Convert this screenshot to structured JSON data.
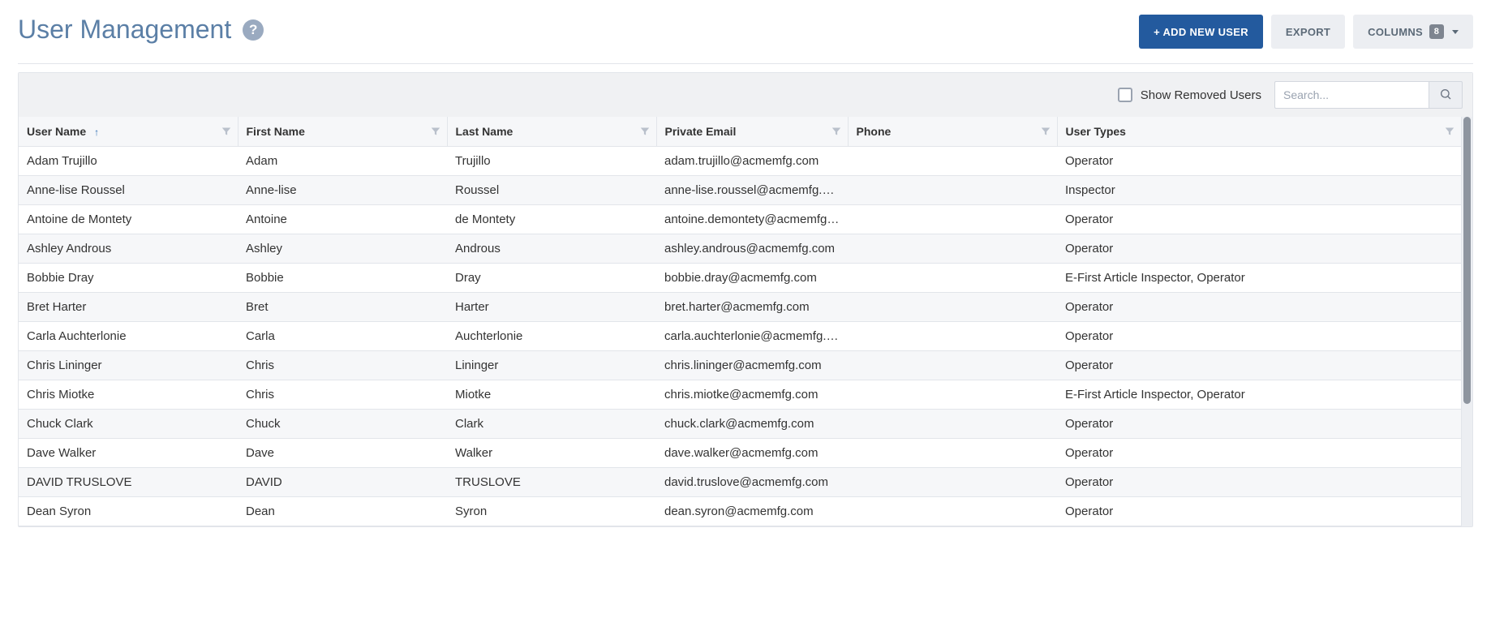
{
  "header": {
    "title": "User Management",
    "add_new_user_label": "+ ADD NEW USER",
    "export_label": "EXPORT",
    "columns_label": "COLUMNS",
    "columns_count": "8"
  },
  "toolbar": {
    "show_removed_label": "Show Removed Users",
    "search_placeholder": "Search..."
  },
  "table": {
    "columns": [
      {
        "key": "username",
        "label": "User Name",
        "sorted": "asc"
      },
      {
        "key": "first_name",
        "label": "First Name"
      },
      {
        "key": "last_name",
        "label": "Last Name"
      },
      {
        "key": "email",
        "label": "Private Email"
      },
      {
        "key": "phone",
        "label": "Phone"
      },
      {
        "key": "user_types",
        "label": "User Types"
      }
    ],
    "rows": [
      {
        "username": "Adam Trujillo",
        "first_name": "Adam",
        "last_name": "Trujillo",
        "email": "adam.trujillo@acmemfg.com",
        "phone": "",
        "user_types": "Operator"
      },
      {
        "username": "Anne-lise Roussel",
        "first_name": "Anne-lise",
        "last_name": "Roussel",
        "email": "anne-lise.roussel@acmemfg.com",
        "phone": "",
        "user_types": "Inspector"
      },
      {
        "username": "Antoine de Montety",
        "first_name": "Antoine",
        "last_name": "de Montety",
        "email": "antoine.demontety@acmemfg....",
        "phone": "",
        "user_types": "Operator"
      },
      {
        "username": "Ashley Androus",
        "first_name": "Ashley",
        "last_name": "Androus",
        "email": "ashley.androus@acmemfg.com",
        "phone": "",
        "user_types": "Operator"
      },
      {
        "username": "Bobbie Dray",
        "first_name": "Bobbie",
        "last_name": "Dray",
        "email": "bobbie.dray@acmemfg.com",
        "phone": "",
        "user_types": "E-First Article Inspector, Operator"
      },
      {
        "username": "Bret Harter",
        "first_name": "Bret",
        "last_name": "Harter",
        "email": "bret.harter@acmemfg.com",
        "phone": "",
        "user_types": "Operator"
      },
      {
        "username": "Carla Auchterlonie",
        "first_name": "Carla",
        "last_name": "Auchterlonie",
        "email": "carla.auchterlonie@acmemfg.c...",
        "phone": "",
        "user_types": "Operator"
      },
      {
        "username": "Chris Lininger",
        "first_name": "Chris",
        "last_name": "Lininger",
        "email": "chris.lininger@acmemfg.com",
        "phone": "",
        "user_types": "Operator"
      },
      {
        "username": "Chris Miotke",
        "first_name": "Chris",
        "last_name": "Miotke",
        "email": "chris.miotke@acmemfg.com",
        "phone": "",
        "user_types": "E-First Article Inspector, Operator"
      },
      {
        "username": "Chuck Clark",
        "first_name": "Chuck",
        "last_name": "Clark",
        "email": "chuck.clark@acmemfg.com",
        "phone": "",
        "user_types": "Operator"
      },
      {
        "username": "Dave Walker",
        "first_name": "Dave",
        "last_name": "Walker",
        "email": "dave.walker@acmemfg.com",
        "phone": "",
        "user_types": "Operator"
      },
      {
        "username": "DAVID TRUSLOVE",
        "first_name": "DAVID",
        "last_name": "TRUSLOVE",
        "email": "david.truslove@acmemfg.com",
        "phone": "",
        "user_types": "Operator"
      },
      {
        "username": "Dean Syron",
        "first_name": "Dean",
        "last_name": "Syron",
        "email": "dean.syron@acmemfg.com",
        "phone": "",
        "user_types": "Operator"
      }
    ]
  }
}
